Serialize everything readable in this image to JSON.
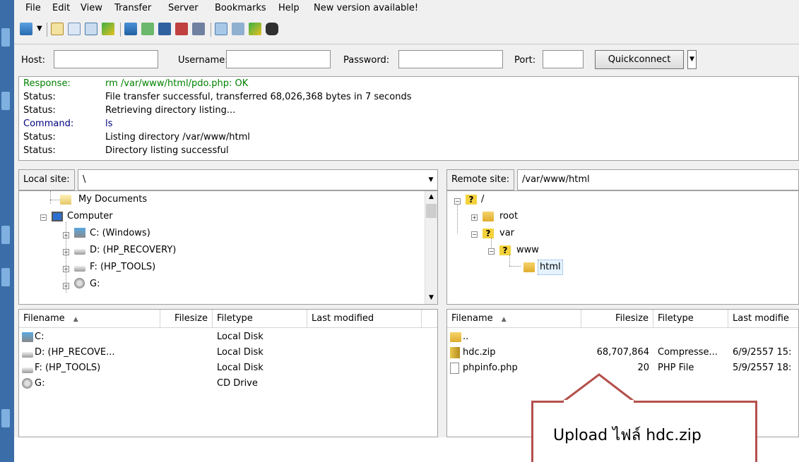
{
  "menu": [
    "File",
    "Edit",
    "View",
    "Transfer",
    "Server",
    "Bookmarks",
    "Help",
    "New version available!"
  ],
  "toolbar_icons": [
    "site-manager-icon",
    "dropdown-arrow-icon",
    "toggle-log-icon",
    "toggle-local-tree-icon",
    "toggle-remote-tree-icon",
    "toggle-queue-icon",
    "refresh-icon",
    "process-queue-icon",
    "cancel-icon",
    "disconnect-icon",
    "reconnect-icon",
    "filter-icon",
    "compare-icon",
    "sync-browse-icon",
    "search-icon"
  ],
  "quickconnect": {
    "host_label": "Host:",
    "host_value": "",
    "username_label": "Username:",
    "username_value": "",
    "password_label": "Password:",
    "password_value": "",
    "port_label": "Port:",
    "port_value": "",
    "button_label": "Quickconnect"
  },
  "log": [
    {
      "type": "Response:",
      "text": "rm /var/www/html/pdo.php: OK",
      "color": "#008000"
    },
    {
      "type": "Status:",
      "text": "File transfer successful, transferred 68,026,368 bytes in 7 seconds",
      "color": "#000000"
    },
    {
      "type": "Status:",
      "text": "Retrieving directory listing...",
      "color": "#000000"
    },
    {
      "type": "Command:",
      "text": "ls",
      "color": "#000080"
    },
    {
      "type": "Status:",
      "text": "Listing directory /var/www/html",
      "color": "#000000"
    },
    {
      "type": "Status:",
      "text": "Directory listing successful",
      "color": "#000000"
    }
  ],
  "local": {
    "site_label": "Local site:",
    "path": "\\",
    "tree": [
      "My Documents",
      "Computer",
      "C: (Windows)",
      "D: (HP_RECOVERY)",
      "F: (HP_TOOLS)",
      "G:"
    ],
    "columns": [
      "Filename",
      "Filesize",
      "Filetype",
      "Last modified"
    ],
    "files": [
      {
        "name": "C:",
        "size": "",
        "type": "Local Disk",
        "modified": ""
      },
      {
        "name": "D: (HP_RECOVE...",
        "size": "",
        "type": "Local Disk",
        "modified": ""
      },
      {
        "name": "F: (HP_TOOLS)",
        "size": "",
        "type": "Local Disk",
        "modified": ""
      },
      {
        "name": "G:",
        "size": "",
        "type": "CD Drive",
        "modified": ""
      }
    ]
  },
  "remote": {
    "site_label": "Remote site:",
    "path": "/var/www/html",
    "tree": [
      "/",
      "root",
      "var",
      "www",
      "html"
    ],
    "columns": [
      "Filename",
      "Filesize",
      "Filetype",
      "Last modifie"
    ],
    "files": [
      {
        "name": "..",
        "size": "",
        "type": "",
        "modified": ""
      },
      {
        "name": "hdc.zip",
        "size": "68,707,864",
        "type": "Compresse...",
        "modified": "6/9/2557 15:"
      },
      {
        "name": "phpinfo.php",
        "size": "20",
        "type": "PHP File",
        "modified": "5/9/2557 18:"
      }
    ]
  },
  "callout": {
    "text": "Upload ไฟล์ hdc.zip",
    "color": "#b4504c"
  }
}
